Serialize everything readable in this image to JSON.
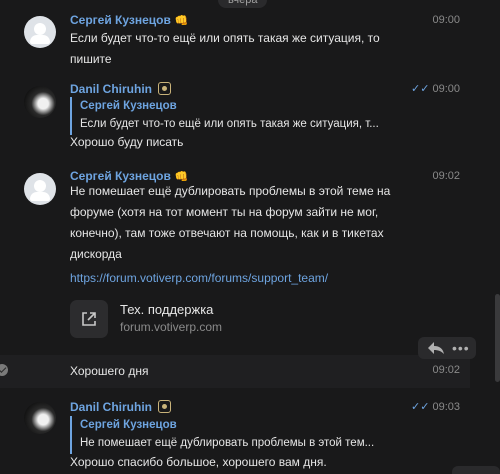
{
  "date_label": "вчера",
  "messages": [
    {
      "author": "Сергей Кузнецов",
      "emoji": "👊",
      "time": "09:00",
      "text": "Если будет что-то ещё или опять такая же ситуация, то\nпишите"
    },
    {
      "author": "Danil Chiruhin",
      "time": "09:00",
      "status": "read",
      "quote": {
        "author": "Сергей Кузнецов",
        "text": "Если будет что-то ещё или опять такая же ситуация, т..."
      },
      "text": "Хорошо буду писать"
    },
    {
      "author": "Сергей Кузнецов",
      "emoji": "👊",
      "time": "09:02",
      "text": "Не помешает ещё дублировать проблемы в этой теме на\nфоруме (хотя на тот момент ты на форум зайти не мог,\nконечно), там тоже отвечают на помощь, как и в тикетах\nдискорда",
      "link": "https://forum.votiverp.com/forums/support_team/",
      "preview": {
        "title": "Тех. поддержка",
        "site": "forum.votiverp.com"
      }
    },
    {
      "time": "09:02",
      "text": "Хорошего дня"
    },
    {
      "author": "Danil Chiruhin",
      "time": "09:03",
      "status": "read",
      "quote": {
        "author": "Сергей Кузнецов",
        "text": "Не помешает ещё дублировать проблемы в этой тем..."
      },
      "text": "Хорошо спасибо большое, хорошего вам дня."
    }
  ],
  "icons": {
    "default_avatar": "user-placeholder-icon",
    "badge": "badge-icon",
    "read": "double-check-icon",
    "external": "external-link-icon",
    "reply": "reply-icon",
    "more": "more-icon"
  },
  "colors": {
    "background": "#19191a",
    "accent": "#6ea4e0",
    "text": "#e6e6e6",
    "muted": "#8a8a8a"
  }
}
